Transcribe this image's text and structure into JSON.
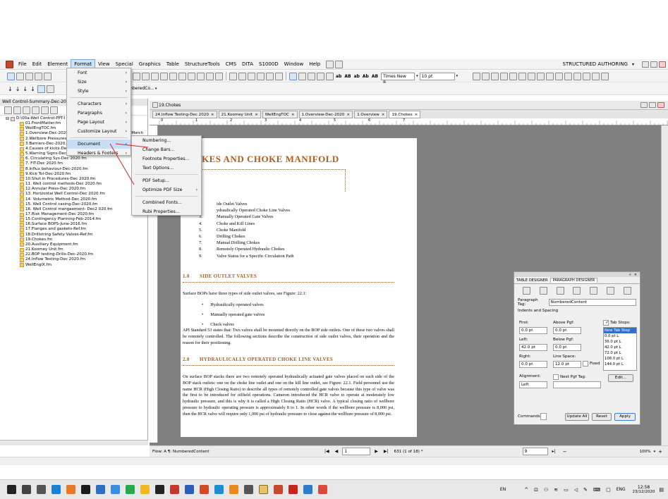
{
  "menubar": {
    "items": [
      "File",
      "Edit",
      "Element",
      "Format",
      "View",
      "Special",
      "Graphics",
      "Table",
      "StructureTools",
      "CMS",
      "DITA",
      "S1000D",
      "Window",
      "Help"
    ],
    "active": "Format",
    "mode_label": "STRUCTURED AUTHORING"
  },
  "toolbar": {
    "font_combo": "Times New R...",
    "size_combo": "10 pt",
    "para_combo": "NumberedCo...",
    "text_buttons": [
      "ab",
      "AB",
      "ab",
      "Ab",
      "AB"
    ]
  },
  "format_menu": {
    "items": [
      {
        "label": "Font",
        "arrow": "›"
      },
      {
        "label": "Size",
        "arrow": "›"
      },
      {
        "label": "Style",
        "arrow": "›"
      },
      {
        "label": "Characters",
        "arrow": "›"
      },
      {
        "label": "Paragraphs",
        "arrow": "›"
      },
      {
        "label": "Page Layout",
        "arrow": "›"
      },
      {
        "label": "Customize Layout",
        "arrow": "›"
      },
      {
        "label": "Document",
        "arrow": "›"
      },
      {
        "label": "Headers & Footers",
        "arrow": "›"
      }
    ]
  },
  "document_menu": {
    "items": [
      "Numbering...",
      "Change Bars...",
      "Footnote Properties...",
      "Text Options...",
      "PDF Setup...",
      "Optimize PDF Size",
      "Combined Fonts...",
      "Rubi Properties..."
    ],
    "arrow": "›"
  },
  "book_pane": {
    "title": "Well Control-Summary-Dec-2020",
    "root": "D:\\00a-Well Control-PPT-I",
    "march_tail": "e-March",
    "files": [
      "01.FrontMatter.fm",
      "WellEngTOC.fm",
      "1.Overview-Dec-2020",
      "2.Wellbore Pressures-I",
      "3.Barriers-Dec-2020.fm",
      "4.Causes of kicks-Dec 2020.fm",
      "5.Warning Signs-Dec-2020.fm",
      "6. Circulating Sys-Dec 2020.fm",
      "7. FIT-Dec 2020.fm",
      "8.Influx behaviour-Dec-2020.fm",
      "9.Kick Tol-Dec-2020.fm",
      "10.Shut in Procedures-Dec 2020.fm",
      "11. Well control methods-Dec 2020.fm",
      "12.Annular Press-Dec 2020.fm",
      "13. Horizontal Well Control-Dec 2020.fm",
      "14. Volumetric Method-Dec 2020.fm",
      "15. Well Control casing-Dec-2020.fm",
      "16. Well Control mangaement- Dec2 020.fm",
      "17.Risk Management-Dec 2020.fm",
      "15.Contingency Planning-Feb-2014.fm",
      "16.Surface BOPS-June-2016.fm",
      "17.Flanges and gaskets-Ref.fm",
      "18.Drillstring Safety Valves-Ref.fm",
      "19.Chokes.fm",
      "20.Auxiliary Equipment.fm",
      "21.Koomey Unit.fm",
      "22.BOP testing-Drills-Dec-2020.fm",
      "24.Inflow Testing-Dec 2020.fm",
      "WellEngIX.fm"
    ]
  },
  "doc_window": {
    "title": "19.Chokes",
    "tabs": [
      "24.Inflow Testing-Dec 2020",
      "21.Koomey Unit",
      "WellEngTOC",
      "1.Overview-Dec-2020",
      "1.Overview",
      "19.Chokes"
    ],
    "ruler_labels": [
      "0",
      "1",
      "2",
      "3",
      "4",
      "5",
      "6",
      "7"
    ]
  },
  "page": {
    "title": "KES AND CHOKE MANIFOLD",
    "toc": [
      "ide Outlet Valves",
      "ydraulically Operated Choke Line Valves",
      "Manually Operated Gate Valves",
      "Choke and Kill Lines",
      "Choke Manifold",
      "Drilling Chokes",
      "Manual Drilling Chokes",
      "Remotely Operated Hydraulic Chokes",
      "Valve Status for a Specific Circulation Path"
    ],
    "toc_nums": [
      "3.",
      "4.",
      "5.",
      "6.",
      "7.",
      "8.",
      "9."
    ],
    "s1_num": "1.0",
    "s1_title": "SIDE OUTLET VALVES",
    "s1_intro": "Surface BOPs have three types of side outlet valves, see Figure: 22.1:",
    "s1_bullets": [
      "Hydraulically operated valves",
      "Manually operated gate valves",
      "Check valves"
    ],
    "s1_para": "API Standard 53 states that: Two valves shall be mounted directly on the BOP side outlets. One of these two valves shall be remotely controlled. The following sections describe the construction of side outlet valves, their operation and the reason for their positioning.",
    "s2_num": "2.0",
    "s2_title": "HYDRAULICALLY OPERATED CHOKE LINE VALVES",
    "s2_para": "On surface BOP stacks there are two remotely operated hydraulically actuated gate valves placed on each side of the BOP stack outlets: one on the choke line outlet and one on the kill line outlet, see Figure: 22.1. Field personnel use the name HCR (High Closing Ratio) to describe all types of remotely controlled gate valves because this type of valve was the first to be introduced for oilfield operations. Cameron introduced the HCR valve to operate at moderately low hydraulic pressure, and this is why it is called a High Closing Ratio (HCR) valve. A typical closing ratio of wellbore pressure to hydraulic operating pressure is approximately 8 to 1. In other words if the wellbore pressure is 8,000 psi, then the HCR valve will require only 1,000 psi of hydraulic pressure to close against the wellbore pressure of 8,000 psi."
  },
  "statusbar": {
    "flow": "Flow: A  ¶: NumberedContent",
    "page_field": "1",
    "page_info": "631 (1 of 18) *",
    "zoom_field": "9",
    "zoom": "100%"
  },
  "para_designer": {
    "tab1": "TABLE DESIGNER",
    "tab2": "PARAGRAPH DESIGNER",
    "tag_label": "Paragraph Tag:",
    "tag_value": "NumberedContent",
    "indents_label": "Indents and Spacing",
    "first_label": "First:",
    "first_value": "0.0 pt",
    "above_label": "Above Pgf:",
    "above_value": "0.0 pt",
    "left_label": "Left:",
    "left_value": "42.0 pt",
    "below_label": "Below Pgf:",
    "below_value": "0.0 pt",
    "right_label": "Right:",
    "right_value": "0.0 pt",
    "linesp_label": "Line Space:",
    "linesp_value": "12.0 pt",
    "fixed_label": "Fixed",
    "tabstops_label": "Tab Stops:",
    "tabstops": [
      "New Tab Stop",
      "0.0 pt  L",
      "36.0 pt  L",
      "42.0 pt  L",
      "72.0 pt  L",
      "108.0 pt  L",
      "144.0 pt  L"
    ],
    "align_label": "Alignment:",
    "align_value": "Left",
    "nextpgf_label": "Next Pgf Tag:",
    "edit_btn": "Edit...",
    "commands_label": "Commands:",
    "update_btn": "Update All",
    "reset_btn": "Reset",
    "apply_btn": "Apply"
  },
  "taskbar": {
    "lang": "EN",
    "lang2": "ENG",
    "time": "12:58",
    "date": "23/12/2020"
  },
  "colors": {
    "accent": "#b25b1b",
    "selection": "#c7def4",
    "arrow": "#d0262b"
  }
}
